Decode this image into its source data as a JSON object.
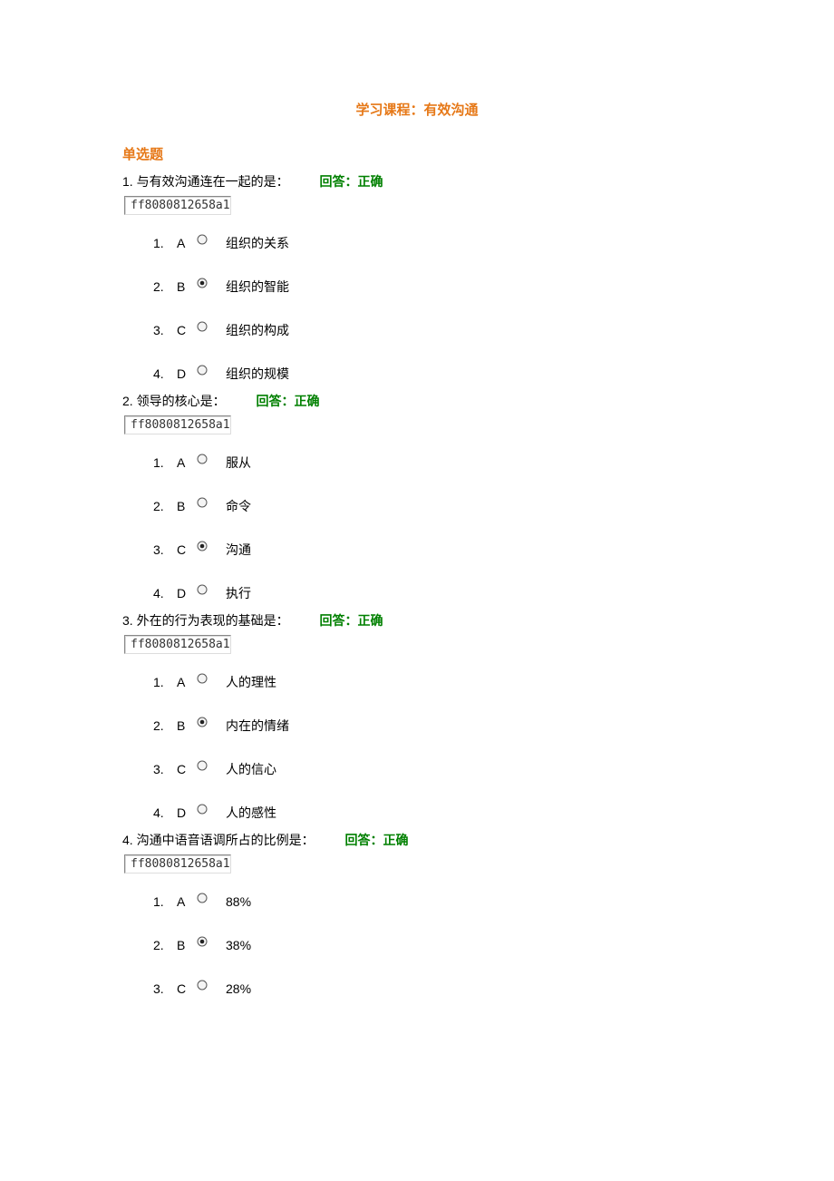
{
  "course_title": "学习课程：有效沟通",
  "section_title": "单选题",
  "code_value": "ff8080812658a1",
  "answer_label": "回答：正确",
  "questions": [
    {
      "number": "1.",
      "text": "与有效沟通连在一起的是：",
      "selected_index": 1,
      "options": [
        {
          "num": "1.",
          "letter": "A",
          "text": "组织的关系"
        },
        {
          "num": "2.",
          "letter": "B",
          "text": "组织的智能"
        },
        {
          "num": "3.",
          "letter": "C",
          "text": "组织的构成"
        },
        {
          "num": "4.",
          "letter": "D",
          "text": "组织的规模"
        }
      ]
    },
    {
      "number": "2.",
      "text": "领导的核心是：",
      "selected_index": 2,
      "options": [
        {
          "num": "1.",
          "letter": "A",
          "text": "服从"
        },
        {
          "num": "2.",
          "letter": "B",
          "text": "命令"
        },
        {
          "num": "3.",
          "letter": "C",
          "text": "沟通"
        },
        {
          "num": "4.",
          "letter": "D",
          "text": "执行"
        }
      ]
    },
    {
      "number": "3.",
      "text": "外在的行为表现的基础是：",
      "selected_index": 1,
      "options": [
        {
          "num": "1.",
          "letter": "A",
          "text": "人的理性"
        },
        {
          "num": "2.",
          "letter": "B",
          "text": "内在的情绪"
        },
        {
          "num": "3.",
          "letter": "C",
          "text": "人的信心"
        },
        {
          "num": "4.",
          "letter": "D",
          "text": "人的感性"
        }
      ]
    },
    {
      "number": "4.",
      "text": "沟通中语音语调所占的比例是：",
      "selected_index": 1,
      "options": [
        {
          "num": "1.",
          "letter": "A",
          "text": "88%"
        },
        {
          "num": "2.",
          "letter": "B",
          "text": "38%"
        },
        {
          "num": "3.",
          "letter": "C",
          "text": "28%"
        }
      ]
    }
  ]
}
